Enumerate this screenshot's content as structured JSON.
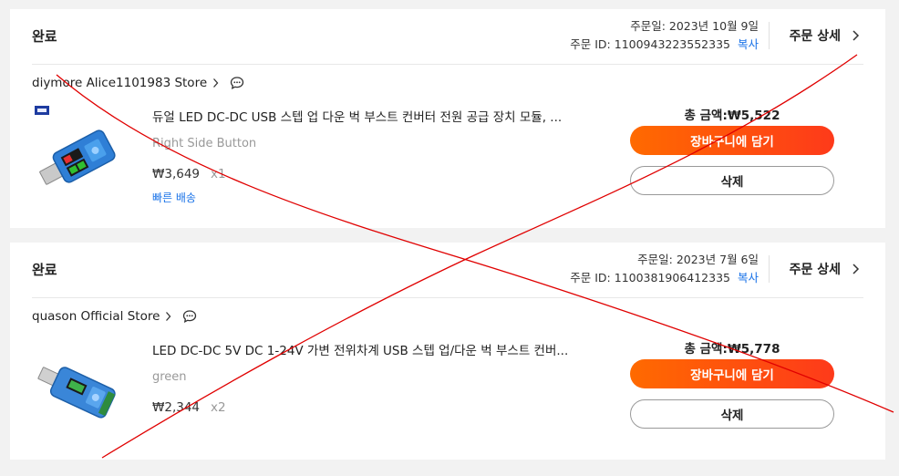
{
  "orders": [
    {
      "status": "완료",
      "order_date": "주문일: 2023년 10월 9일",
      "order_id": "주문 ID: 1100943223552335",
      "copy_label": "복사",
      "detail_label": "주문 상세",
      "store_name": "diymore Alice1101983 Store",
      "item_title": "듀얼 LED DC-DC USB 스텝 업 다운 벅 부스트 컨버터 전원 공급 장치 모듈, ...",
      "item_variant": "Right Side Button",
      "item_price": "₩3,649",
      "item_qty": "x1",
      "shipping_badge": "빠른 배송",
      "total": "총 금액:₩5,522",
      "cart_label": "장바구니에 담기",
      "delete_label": "삭제"
    },
    {
      "status": "완료",
      "order_date": "주문일: 2023년 7월 6일",
      "order_id": "주문 ID: 1100381906412335",
      "copy_label": "복사",
      "detail_label": "주문 상세",
      "store_name": "quason Official Store",
      "item_title": "LED DC-DC 5V DC 1-24V 가변 전위차계 USB 스텝 업/다운 벅 부스트 컨버...",
      "item_variant": "green",
      "item_price": "₩2,344",
      "item_qty": "x2",
      "total": "총 금액:₩5,778",
      "cart_label": "장바구니에 담기",
      "delete_label": "삭제"
    }
  ],
  "icons": {
    "chevron": "chevron-right-icon",
    "chat": "chat-bubble-icon"
  },
  "colors": {
    "accent": "#ff5a14",
    "link": "#1a73e8",
    "annotation": "#e00000"
  }
}
